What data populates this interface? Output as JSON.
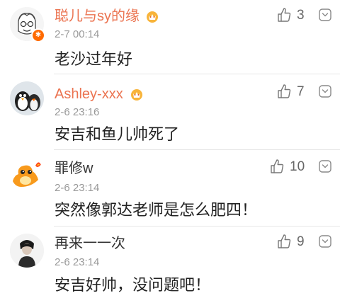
{
  "comments": [
    {
      "username": "聪儿与sy的缘",
      "time": "2-7 00:14",
      "text": "老沙过年好",
      "likes": "3",
      "avatar_icon": "cartoon-avatar-icon",
      "has_vip": true,
      "verified": true
    },
    {
      "username": "Ashley-xxx",
      "time": "2-6 23:16",
      "text": "安吉和鱼儿帅死了",
      "likes": "7",
      "avatar_icon": "penguin-avatar-icon",
      "has_vip": true,
      "verified": false
    },
    {
      "username": "罪修w",
      "time": "2-6 23:14",
      "text": "突然像郭达老师是怎么肥四！",
      "likes": "10",
      "avatar_icon": "charmander-avatar-icon",
      "has_vip": false,
      "verified": false
    },
    {
      "username": "再来一一次",
      "time": "2-6 23:14",
      "text": "安吉好帅，没问题吧！",
      "likes": "9",
      "avatar_icon": "person-photo-avatar-icon",
      "has_vip": false,
      "verified": false
    }
  ],
  "colors": {
    "accent_username": "#eb7350",
    "timestamp": "#999999",
    "badge": "#ff6a00"
  }
}
